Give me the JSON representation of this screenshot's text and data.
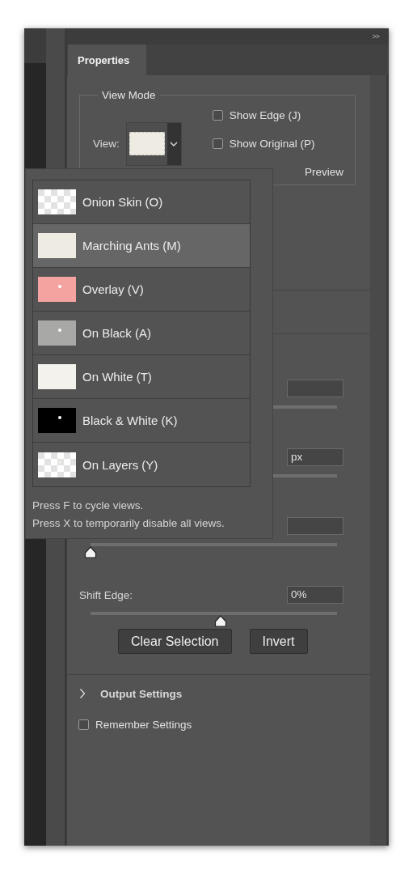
{
  "panel": {
    "collapse_button": ">>"
  },
  "tabs": [
    {
      "label": "Properties",
      "selected": true
    }
  ],
  "view_mode": {
    "legend": "View Mode",
    "view_label": "View:",
    "checkboxes": [
      {
        "label": "Show Edge (J)",
        "checked": false
      },
      {
        "label": "Show Original (P)",
        "checked": false
      }
    ],
    "cut_label": "Preview"
  },
  "sliders": [
    {
      "kind": "plain"
    },
    {
      "kind": "plain",
      "value": "px"
    },
    {
      "kind": "plain",
      "level": 0
    },
    {
      "kind": "labeled",
      "label": "Shift Edge:",
      "value": "0%",
      "level": 0.5
    }
  ],
  "buttons": [
    "Clear Selection",
    "Invert"
  ],
  "output_settings": {
    "label": "Output Settings",
    "expanded": false
  },
  "remember_settings": {
    "label": "Remember Settings",
    "checked": false
  },
  "view_menu": {
    "items": [
      {
        "label": "Onion Skin (O)",
        "kind": "checker",
        "selected": false
      },
      {
        "label": "Marching Ants (M)",
        "kind": "light",
        "selected": true
      },
      {
        "label": "Overlay (V)",
        "kind": "pink",
        "selected": false
      },
      {
        "label": "On Black (A)",
        "kind": "gray",
        "selected": false
      },
      {
        "label": "On White (T)",
        "kind": "white",
        "selected": false
      },
      {
        "label": "Black & White (K)",
        "kind": "black",
        "selected": false
      },
      {
        "label": "On Layers (Y)",
        "kind": "layers",
        "selected": false
      }
    ],
    "hints": [
      "Press F to cycle views.",
      "Press X to temporarily disable all views."
    ]
  }
}
